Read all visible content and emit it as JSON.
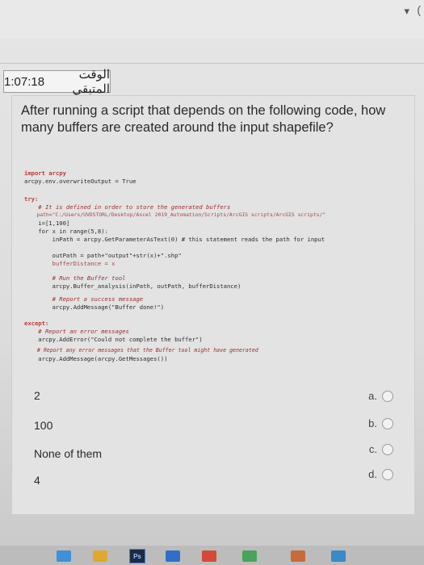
{
  "timer": {
    "time": "1:07:18",
    "label": "الوقت المتبقي"
  },
  "corner": {
    "fragment": "("
  },
  "question": {
    "text": "After running a script that depends on the following code, how many buffers are created around the input shapefile?"
  },
  "code_lines": [
    "import arcpy",
    "arcpy.env.overwriteOutput = True",
    "try:",
    "    # It is defined in order to store the generated buffers",
    "    path=\"C:/Users/UVDSTORL/Desktop/Ascel 2019_Automation/Scripts/ArcGIS scripts/ArcGIS scripts/\"",
    "    i=[1,100]",
    "    for x in range(5,8):",
    "        inPath = arcpy.GetParameterAsText(0) # this statement reads the path for input",
    "        outPath = path+\"output\"+str(x)+\".shp\"",
    "        bufferDistance = x",
    "        # Run the Buffer tool",
    "        arcpy.Buffer_analysis(inPath, outPath, bufferDistance)",
    "        # Report a success message",
    "        arcpy.AddMessage(\"Buffer done!\")",
    "except:",
    "    # Report an error messages",
    "    arcpy.AddError(\"Could not complete the buffer\")",
    "    # Report any error messages that the Buffer tool might have generated",
    "    arcpy.AddMessage(arcpy.GetMessages())"
  ],
  "options": [
    {
      "text": "2",
      "letter": "a."
    },
    {
      "text": "100",
      "letter": "b."
    },
    {
      "text": "None of them",
      "letter": "c."
    },
    {
      "text": "4",
      "letter": "d."
    }
  ],
  "taskbar": {
    "ps_label": "Ps"
  }
}
